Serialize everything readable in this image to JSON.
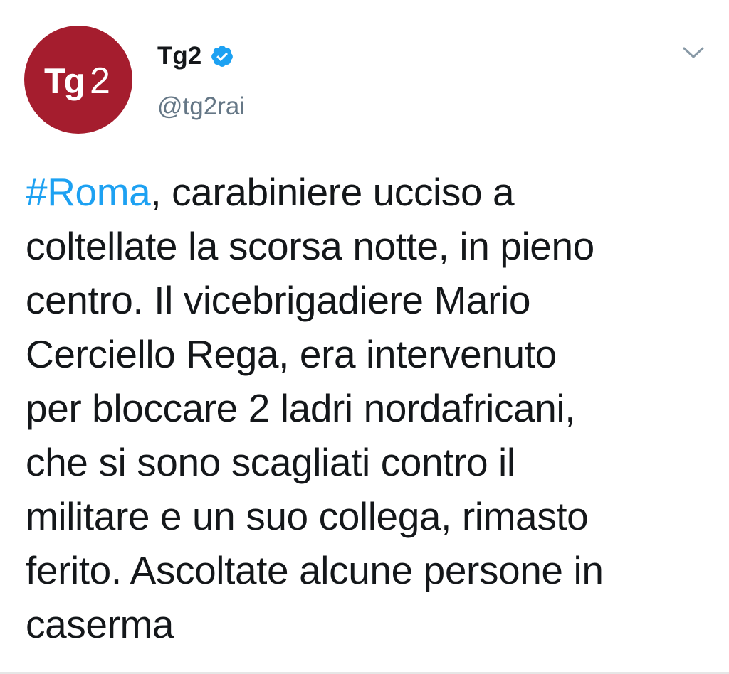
{
  "tweet": {
    "avatar_logo": "Tg2",
    "display_name": "Tg2",
    "handle": "@tg2rai",
    "verified_icon": "verified-badge-icon",
    "menu_icon": "chevron-down-icon",
    "hashtag": "#Roma",
    "text_lines": [
      ", carabiniere ucciso a",
      "coltellate la scorsa notte, in pieno",
      "centro. Il vicebrigadiere Mario",
      "Cerciello Rega, era intervenuto",
      "per bloccare 2 ladri nordafricani,",
      "che si sono scagliati contro il",
      "militare e un suo collega, rimasto",
      "ferito. Ascoltate alcune persone in",
      "caserma"
    ]
  },
  "colors": {
    "avatar_bg": "#a51d2e",
    "hashtag": "#1da1f2",
    "verified": "#1da1f2",
    "handle": "#657786",
    "text": "#14171a"
  }
}
